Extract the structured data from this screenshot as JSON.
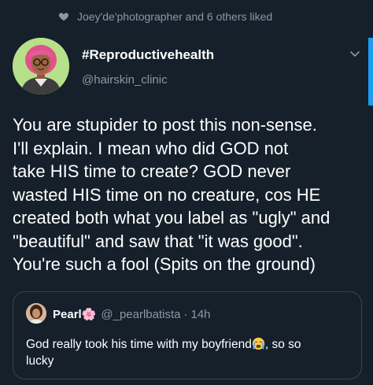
{
  "social_context": {
    "icon": "heart-icon",
    "text": "Joey'de'photographer and 6 others liked"
  },
  "author": {
    "display_name": "#Reproductivehealth",
    "handle": "@hairskin_clinic",
    "avatar": "avatar-illustration"
  },
  "tweet": {
    "lines": [
      "You are stupider to post this non-sense.",
      "I'll explain. I mean who did GOD not",
      "take HIS time to create? GOD never",
      "wasted HIS time on no creature, cos HE",
      "created both what you label as \"ugly\" and",
      "\"beautiful\" and saw that \"it was good\".",
      "You're such a fool (Spits on the ground)"
    ]
  },
  "quoted_tweet": {
    "name": "Pearl🌸",
    "handle": "@_pearlbatista",
    "separator": "·",
    "time": "14h",
    "text_before_emoji": "God really took his time with my boyfriend",
    "emoji": "crying-face-icon",
    "text_after_emoji": ", so so",
    "text_line2": "lucky"
  },
  "colors": {
    "background": "#15202b",
    "secondary_text": "#8899a6",
    "border": "#38444d",
    "accent": "#1d9bf0"
  }
}
